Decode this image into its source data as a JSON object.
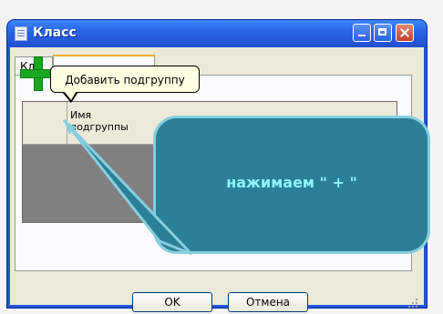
{
  "window": {
    "title": "Класс"
  },
  "tabs": [
    {
      "label": "Кл"
    },
    {
      "label": ""
    }
  ],
  "toolbar": {
    "tooltip": "Добавить подгруппу",
    "add_icon": "plus-icon",
    "remove_icon": "minus-icon",
    "edit_icon": "pencil-icon"
  },
  "table": {
    "columns": [
      "Имя подгруппы"
    ]
  },
  "buttons": {
    "ok": "OK",
    "cancel": "Отмена"
  },
  "callout": {
    "text": "нажимаем \" + \""
  },
  "colors": {
    "titlebar": "#2a66e8",
    "callout_bg": "#2b7f97",
    "callout_text": "#8ff4ff",
    "add_icon": "#17a81f",
    "remove_icon": "#d21f1f"
  }
}
